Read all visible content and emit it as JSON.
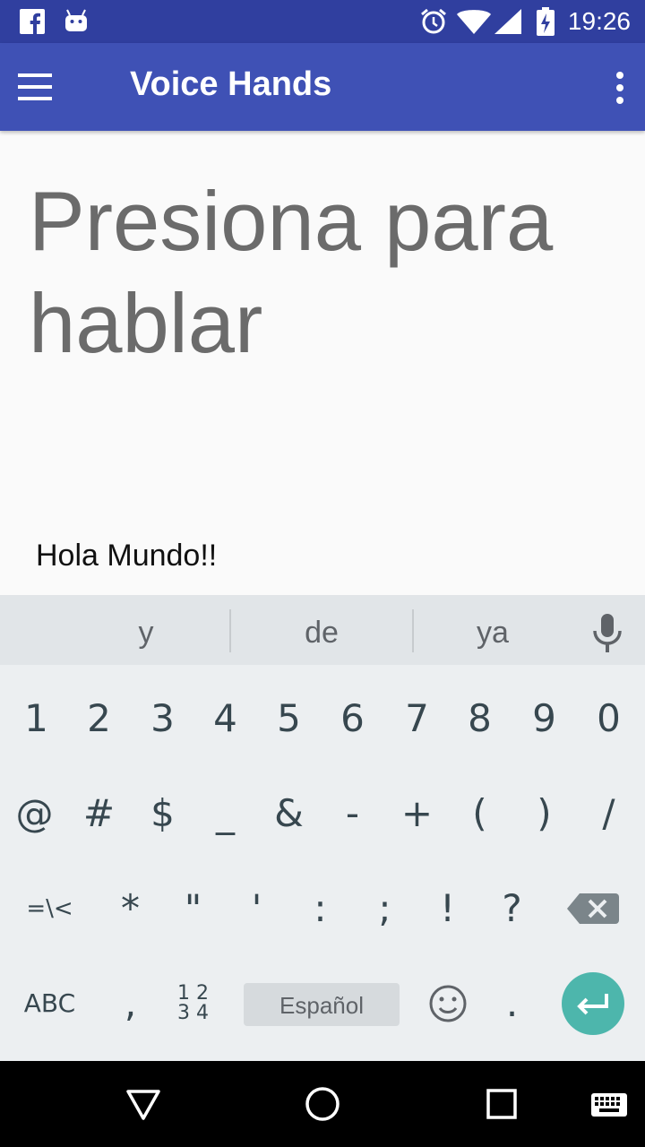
{
  "status_bar": {
    "time": "19:26",
    "icons": [
      "facebook-icon",
      "android-icon",
      "alarm-icon",
      "wifi-icon",
      "cell-signal-icon",
      "battery-charging-icon"
    ]
  },
  "app_bar": {
    "title": "Voice Hands",
    "menu_icon": "hamburger-icon",
    "overflow_icon": "more-vert-icon"
  },
  "main": {
    "prompt": "Presiona para hablar",
    "result": "Hola Mundo!!"
  },
  "keyboard": {
    "suggestions": [
      "y",
      "de",
      "ya"
    ],
    "row1": [
      "1",
      "2",
      "3",
      "4",
      "5",
      "6",
      "7",
      "8",
      "9",
      "0"
    ],
    "row2": [
      "@",
      "#",
      "$",
      "_",
      "&",
      "-",
      "+",
      "(",
      ")",
      "/"
    ],
    "row3": [
      "=\\<",
      "*",
      "\"",
      "'",
      ":",
      ";",
      "!",
      "?"
    ],
    "row4": {
      "abc": "ABC",
      "comma": ",",
      "num_top": "1 2",
      "num_bottom": "3 4",
      "space": "Español",
      "period": "."
    },
    "accent_color": "#4db6ac"
  },
  "colors": {
    "status_bar": "#303f9f",
    "app_bar": "#3f51b5"
  }
}
